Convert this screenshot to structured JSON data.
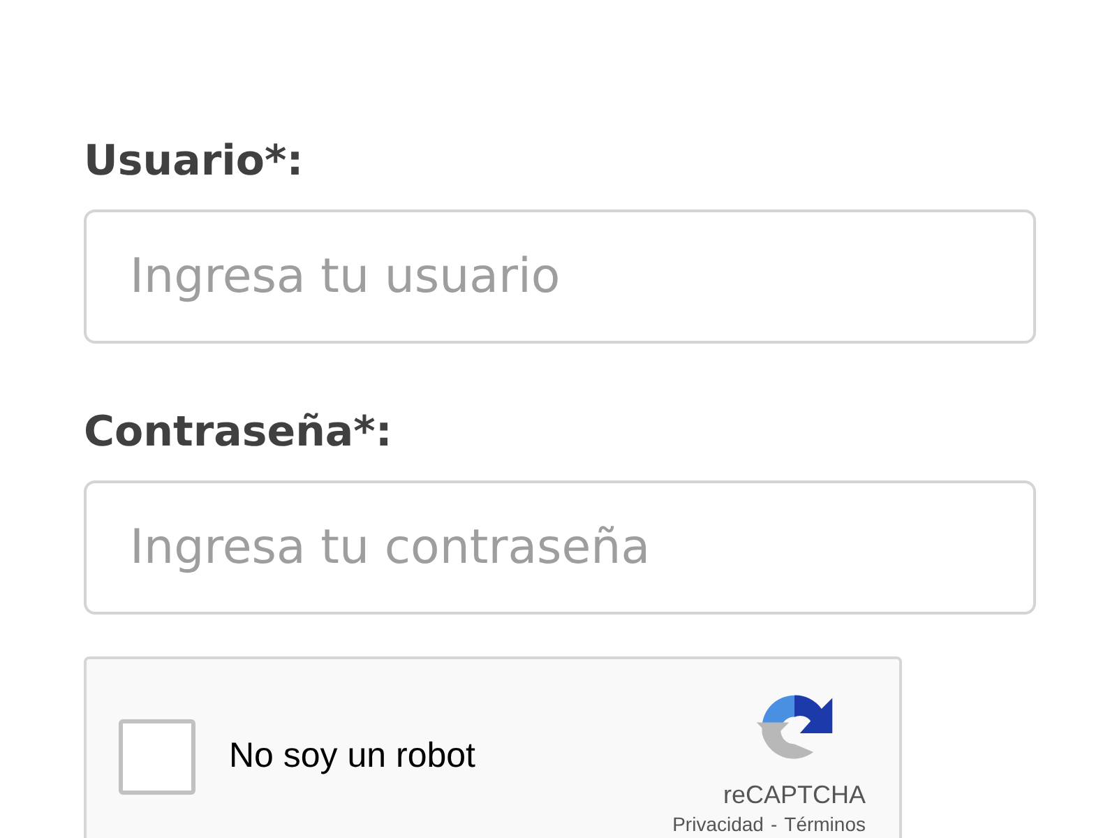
{
  "fields": [
    {
      "label": "Usuario*:",
      "placeholder": "Ingresa tu usuario"
    },
    {
      "label": "Contraseña*:",
      "placeholder": "Ingresa tu contraseña"
    }
  ],
  "captcha": {
    "checked": false,
    "label": "No soy un robot",
    "brand": "reCAPTCHA",
    "links": [
      "Privacidad",
      "Términos"
    ],
    "separator": "-"
  }
}
